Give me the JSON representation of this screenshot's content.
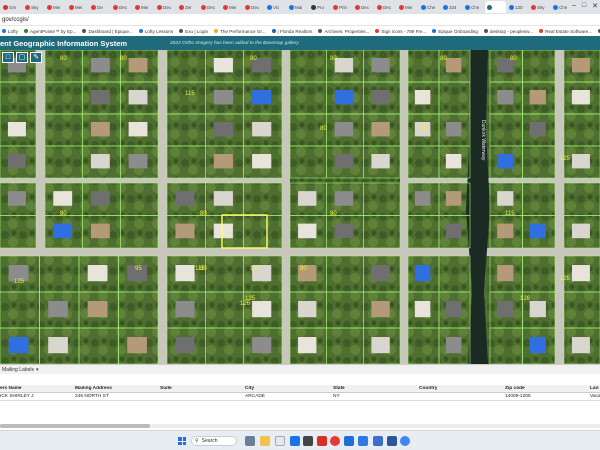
{
  "browser": {
    "tabs": [
      {
        "label": "Gm",
        "color": "#d93025"
      },
      {
        "label": "Sky",
        "color": "#e53935"
      },
      {
        "label": "Mei",
        "color": "#e53935"
      },
      {
        "label": "Mei",
        "color": "#e53935"
      },
      {
        "label": "De",
        "color": "#e53935"
      },
      {
        "label": "Dec",
        "color": "#e53935"
      },
      {
        "label": "Mei",
        "color": "#e53935"
      },
      {
        "label": "Dec",
        "color": "#e53935"
      },
      {
        "label": "Zer",
        "color": "#e53935"
      },
      {
        "label": "Dec",
        "color": "#e53935"
      },
      {
        "label": "Mei",
        "color": "#e53935"
      },
      {
        "label": "Dec",
        "color": "#e53935"
      },
      {
        "label": "Vic",
        "color": "#1a73e8"
      },
      {
        "label": "Mai",
        "color": "#1a73e8"
      },
      {
        "label": "Pro",
        "color": "#333333"
      },
      {
        "label": "Prin",
        "color": "#e53935"
      },
      {
        "label": "Dec",
        "color": "#e53935"
      },
      {
        "label": "Dec",
        "color": "#e53935"
      },
      {
        "label": "Mei",
        "color": "#e53935"
      },
      {
        "label": "Che",
        "color": "#1a73e8"
      },
      {
        "label": "334",
        "color": "#1a73e8"
      },
      {
        "label": "Che",
        "color": "#1a73e8"
      },
      {
        "label": "",
        "color": "#1f6b7b"
      },
      {
        "label": "130",
        "color": "#1a73e8"
      },
      {
        "label": "Sky",
        "color": "#e53935"
      },
      {
        "label": "Che",
        "color": "#1a73e8"
      }
    ],
    "active_tab_index": 22,
    "url": "gov/ccgis/",
    "bookmarks": [
      {
        "label": "Lofty",
        "color": "#1a73e8"
      },
      {
        "label": "AgentPointe™ by Ep...",
        "color": "#2e7d32"
      },
      {
        "label": "Dashboard | Epique...",
        "color": "#555555"
      },
      {
        "label": "Lofty Lessons",
        "color": "#1a73e8"
      },
      {
        "label": "Exu | Login",
        "color": "#555555"
      },
      {
        "label": "The Performance Gr...",
        "color": "#f9a825"
      },
      {
        "label": "| Florida Realtors",
        "color": "#1565c0"
      },
      {
        "label": "Archives: Properties...",
        "color": "#555555"
      },
      {
        "label": "Sign icons - 789 Fre...",
        "color": "#e53935"
      },
      {
        "label": "Epique Onboarding",
        "color": "#1a73e8"
      },
      {
        "label": "desktop - peoplesw...",
        "color": "#555555"
      },
      {
        "label": "Real Estate Software...",
        "color": "#e53935"
      },
      {
        "label": "http://app.dreamigl...",
        "color": "#555555"
      },
      {
        "label": "We Make MLS Easy...",
        "color": "#2e7d32"
      }
    ]
  },
  "app": {
    "title": "ent Geographic Information System",
    "notice": "2023 Ortho Imagery has been added to the Basemap gallery"
  },
  "map": {
    "canal_label": "Dunkirk Waterway",
    "parcel_numbers": [
      "80",
      "125",
      "80",
      "125",
      "80",
      "115",
      "95",
      "80",
      "80",
      "80",
      "126",
      "125",
      "80",
      "80",
      "115",
      "80",
      "80",
      "115",
      "125",
      "126",
      "125",
      "80",
      "80",
      "80"
    ]
  },
  "mailing_labels": {
    "label": "Mailing Labels"
  },
  "table": {
    "columns": [
      "ers Name",
      "Mailing Address",
      "Suite",
      "City",
      "State",
      "Country",
      "Zip code",
      "Lan"
    ],
    "rows": [
      [
        "ICK SHIRLEY J",
        "245 NORTH ST",
        "",
        "ARCADE",
        "NY",
        "",
        "14009-1205",
        "Vaca"
      ]
    ]
  },
  "taskbar": {
    "search_placeholder": "Search"
  }
}
